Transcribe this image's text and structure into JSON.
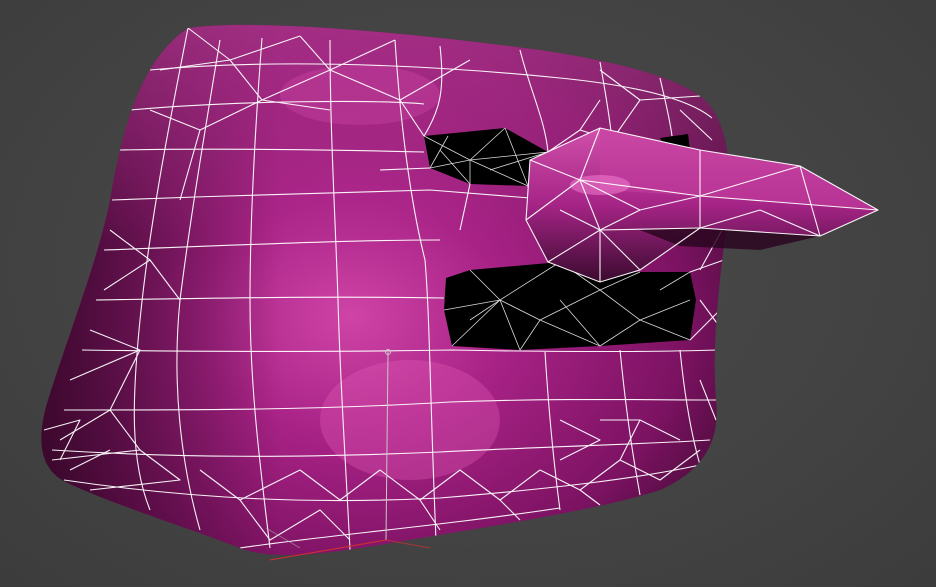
{
  "app": {
    "viewport": "perspective",
    "shading": "smooth-shaded-with-wireframe"
  },
  "model": {
    "surface_color": "#a0207e",
    "highlight_color": "#d448aa",
    "shadow_color": "#3a0a2c",
    "wire_color": "#ffffff",
    "hole_color": "#000000"
  },
  "gizmo": {
    "x_axis_color": "#d03030",
    "y_axis_color": "#c8c8c8",
    "z_axis_color": "#b0b0b0"
  },
  "background_color": "#444444"
}
